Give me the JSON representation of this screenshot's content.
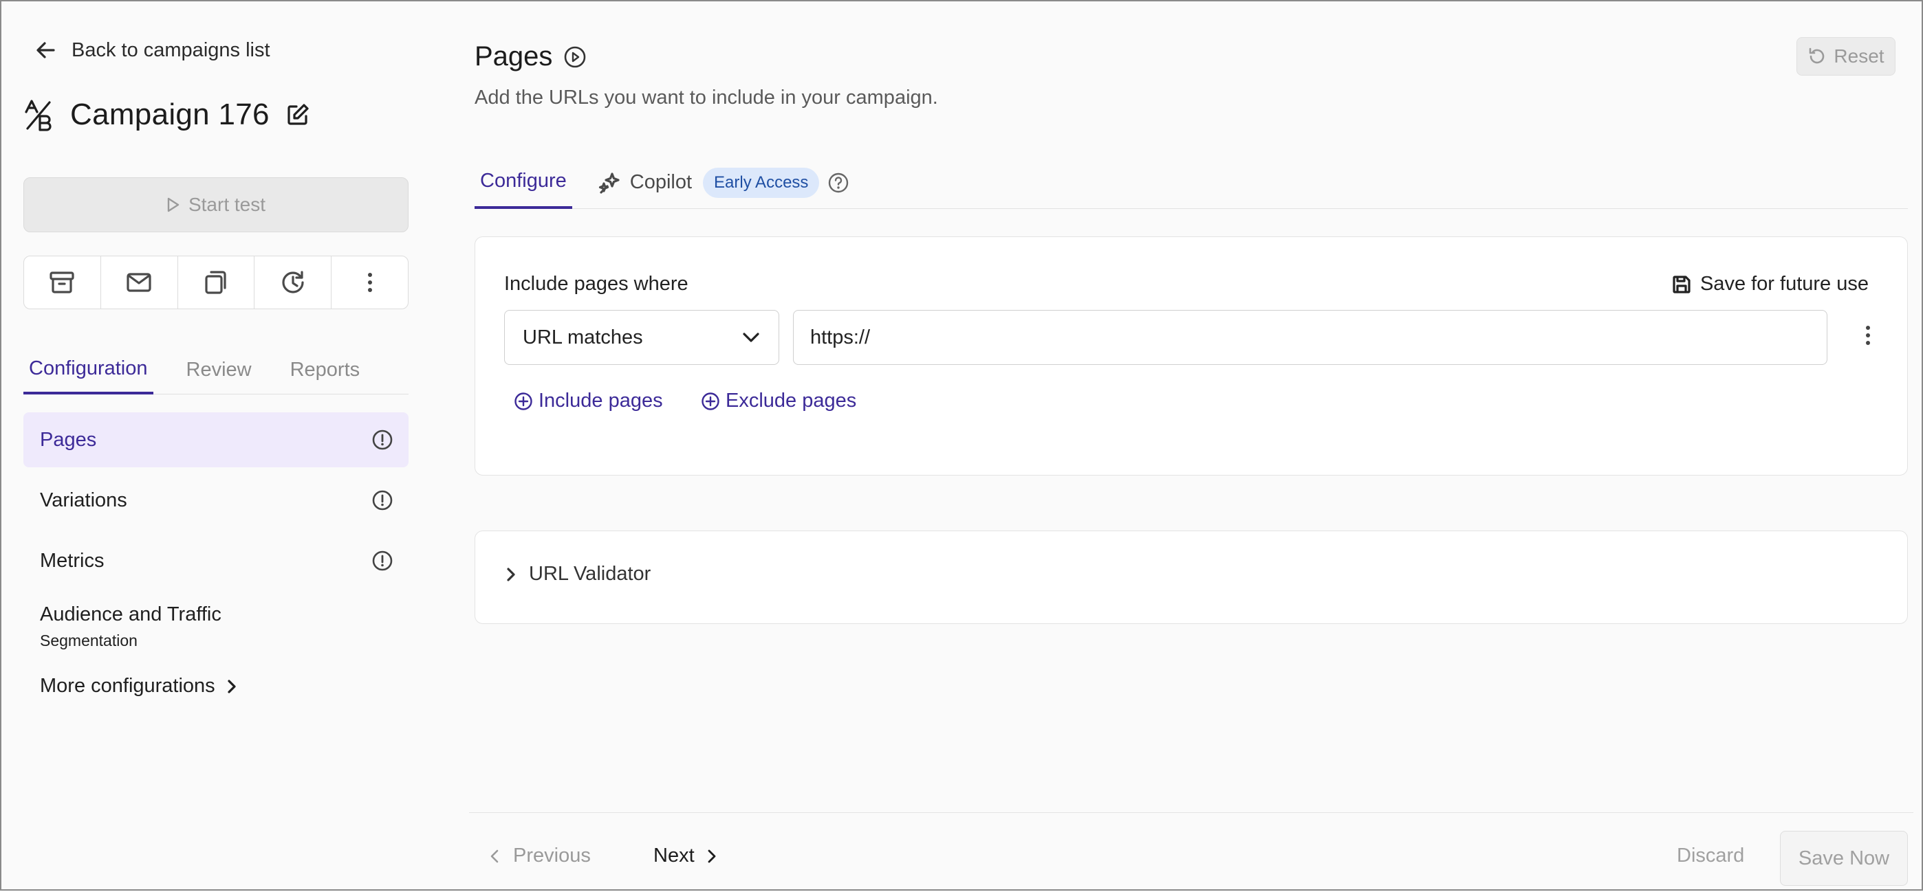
{
  "sidebar": {
    "back_label": "Back to campaigns list",
    "campaign_title": "Campaign 176",
    "start_test_label": "Start test",
    "actions": [
      "archive-icon",
      "mail-icon",
      "duplicate-icon",
      "history-icon",
      "more-vertical-icon"
    ],
    "tabs": [
      {
        "label": "Configuration",
        "active": true
      },
      {
        "label": "Review",
        "active": false
      },
      {
        "label": "Reports",
        "active": false
      }
    ],
    "nav": [
      {
        "label": "Pages",
        "active": true,
        "warning": true
      },
      {
        "label": "Variations",
        "active": false,
        "warning": true
      },
      {
        "label": "Metrics",
        "active": false,
        "warning": true
      }
    ],
    "audience": {
      "title": "Audience and Traffic",
      "subtitle": "Segmentation"
    },
    "more_label": "More configurations"
  },
  "main": {
    "title": "Pages",
    "subtitle": "Add the URLs you want to include in your campaign.",
    "reset_label": "Reset",
    "tabs": {
      "configure": "Configure",
      "copilot": "Copilot",
      "badge": "Early Access"
    },
    "include": {
      "label": "Include pages where",
      "save_label": "Save for future use",
      "select_value": "URL matches",
      "url_value": "https://",
      "include_btn": "Include pages",
      "exclude_btn": "Exclude pages"
    },
    "validator_label": "URL Validator"
  },
  "footer": {
    "previous": "Previous",
    "next": "Next",
    "discard": "Discard",
    "save_now": "Save Now"
  },
  "colors": {
    "accent": "#3c2a98",
    "active_bg": "#efeafc",
    "badge_bg": "#dce8fb"
  }
}
